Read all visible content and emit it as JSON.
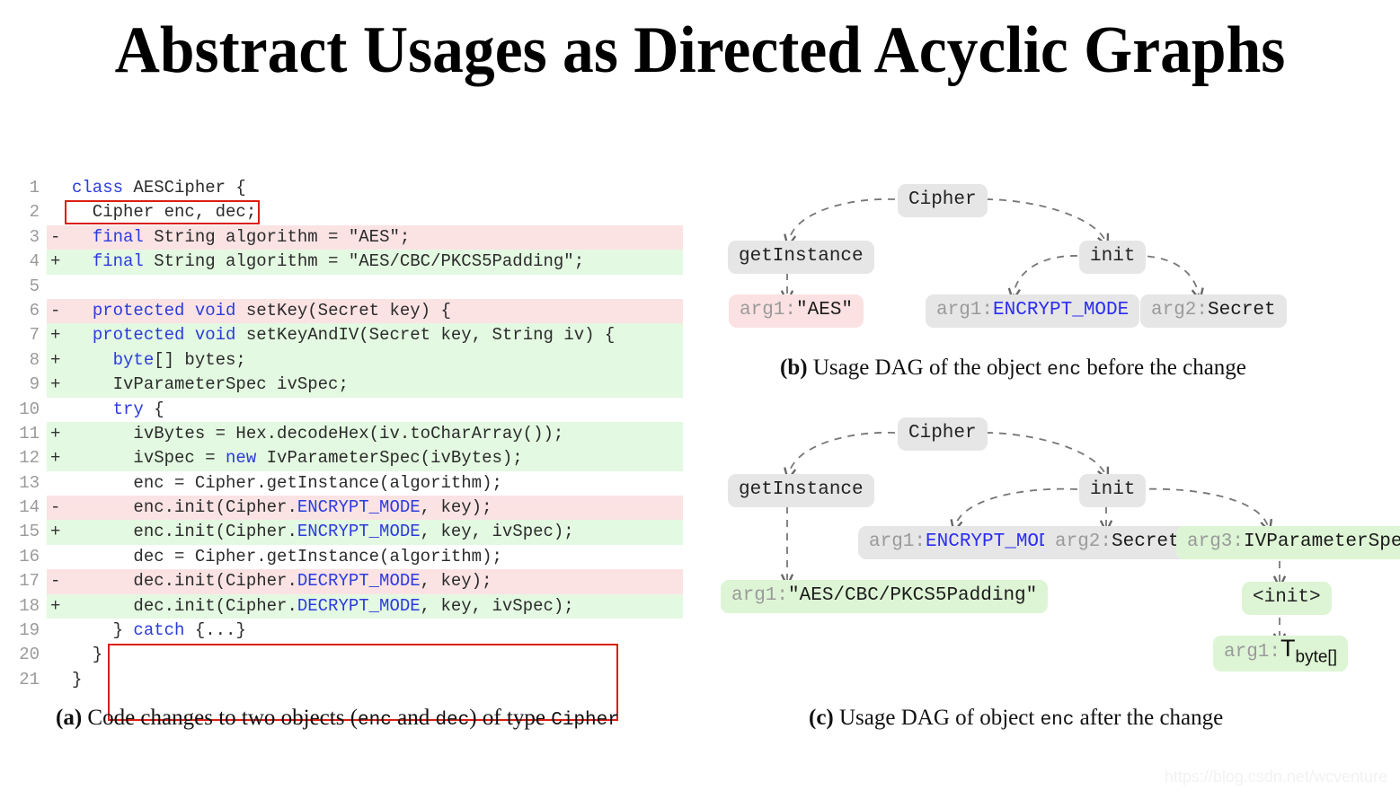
{
  "title": "Abstract Usages as Directed Acyclic Graphs",
  "code": {
    "lines": [
      {
        "n": "1",
        "sign": "",
        "type": "none",
        "text": "class AESCipher {",
        "spans": [
          {
            "t": "class",
            "c": "kw"
          },
          {
            "t": " AESCipher {",
            "c": ""
          }
        ]
      },
      {
        "n": "2",
        "sign": "",
        "type": "none",
        "text": "  Cipher enc, dec;",
        "spans": [
          {
            "t": "  Cipher enc, dec;",
            "c": ""
          }
        ]
      },
      {
        "n": "3",
        "sign": "-",
        "type": "del",
        "text": "  final String algorithm = \"AES\";",
        "spans": [
          {
            "t": "  ",
            "c": ""
          },
          {
            "t": "final",
            "c": "kw"
          },
          {
            "t": " String algorithm = \"AES\";",
            "c": ""
          }
        ]
      },
      {
        "n": "4",
        "sign": "+",
        "type": "add",
        "text": "  final String algorithm = \"AES/CBC/PKCS5Padding\";",
        "spans": [
          {
            "t": "  ",
            "c": ""
          },
          {
            "t": "final",
            "c": "kw"
          },
          {
            "t": " String algorithm = \"AES/CBC/PKCS5Padding\";",
            "c": ""
          }
        ]
      },
      {
        "n": "5",
        "sign": "",
        "type": "none",
        "text": "",
        "spans": []
      },
      {
        "n": "6",
        "sign": "-",
        "type": "del",
        "text": "  protected void setKey(Secret key) {",
        "spans": [
          {
            "t": "  ",
            "c": ""
          },
          {
            "t": "protected",
            "c": "kw"
          },
          {
            "t": " ",
            "c": ""
          },
          {
            "t": "void",
            "c": "kw"
          },
          {
            "t": " setKey(Secret key) {",
            "c": ""
          }
        ]
      },
      {
        "n": "7",
        "sign": "+",
        "type": "add",
        "text": "  protected void setKeyAndIV(Secret key, String iv) {",
        "spans": [
          {
            "t": "  ",
            "c": ""
          },
          {
            "t": "protected",
            "c": "kw"
          },
          {
            "t": " ",
            "c": ""
          },
          {
            "t": "void",
            "c": "kw"
          },
          {
            "t": " setKeyAndIV(Secret key, String iv) {",
            "c": ""
          }
        ]
      },
      {
        "n": "8",
        "sign": "+",
        "type": "add",
        "text": "    byte[] bytes;",
        "spans": [
          {
            "t": "    ",
            "c": ""
          },
          {
            "t": "byte",
            "c": "kw"
          },
          {
            "t": "[] bytes;",
            "c": ""
          }
        ]
      },
      {
        "n": "9",
        "sign": "+",
        "type": "add",
        "text": "    IvParameterSpec ivSpec;",
        "spans": [
          {
            "t": "    IvParameterSpec ivSpec;",
            "c": ""
          }
        ]
      },
      {
        "n": "10",
        "sign": "",
        "type": "none",
        "text": "    try {",
        "spans": [
          {
            "t": "    ",
            "c": ""
          },
          {
            "t": "try",
            "c": "kw"
          },
          {
            "t": " {",
            "c": ""
          }
        ]
      },
      {
        "n": "11",
        "sign": "+",
        "type": "add",
        "text": "      ivBytes = Hex.decodeHex(iv.toCharArray());",
        "spans": [
          {
            "t": "      ivBytes = Hex.decodeHex(iv.toCharArray());",
            "c": ""
          }
        ]
      },
      {
        "n": "12",
        "sign": "+",
        "type": "add",
        "text": "      ivSpec = new IvParameterSpec(ivBytes);",
        "spans": [
          {
            "t": "      ivSpec = ",
            "c": ""
          },
          {
            "t": "new",
            "c": "kw"
          },
          {
            "t": " IvParameterSpec(ivBytes);",
            "c": ""
          }
        ]
      },
      {
        "n": "13",
        "sign": "",
        "type": "none",
        "text": "      enc = Cipher.getInstance(algorithm);",
        "spans": [
          {
            "t": "      enc = Cipher.getInstance(algorithm);",
            "c": ""
          }
        ]
      },
      {
        "n": "14",
        "sign": "-",
        "type": "del",
        "text": "      enc.init(Cipher.ENCRYPT_MODE, key);",
        "spans": [
          {
            "t": "      enc.init(Cipher.",
            "c": ""
          },
          {
            "t": "ENCRYPT_MODE",
            "c": "cn"
          },
          {
            "t": ", key);",
            "c": ""
          }
        ]
      },
      {
        "n": "15",
        "sign": "+",
        "type": "add",
        "text": "      enc.init(Cipher.ENCRYPT_MODE, key, ivSpec);",
        "spans": [
          {
            "t": "      enc.init(Cipher.",
            "c": ""
          },
          {
            "t": "ENCRYPT_MODE",
            "c": "cn"
          },
          {
            "t": ", key, ivSpec);",
            "c": ""
          }
        ]
      },
      {
        "n": "16",
        "sign": "",
        "type": "none",
        "text": "      dec = Cipher.getInstance(algorithm);",
        "spans": [
          {
            "t": "      dec = Cipher.getInstance(algorithm);",
            "c": ""
          }
        ]
      },
      {
        "n": "17",
        "sign": "-",
        "type": "del",
        "text": "      dec.init(Cipher.DECRYPT_MODE, key);",
        "spans": [
          {
            "t": "      dec.init(Cipher.",
            "c": ""
          },
          {
            "t": "DECRYPT_MODE",
            "c": "cn"
          },
          {
            "t": ", key);",
            "c": ""
          }
        ]
      },
      {
        "n": "18",
        "sign": "+",
        "type": "add",
        "text": "      dec.init(Cipher.DECRYPT_MODE, key, ivSpec);",
        "spans": [
          {
            "t": "      dec.init(Cipher.",
            "c": ""
          },
          {
            "t": "DECRYPT_MODE",
            "c": "cn"
          },
          {
            "t": ", key, ivSpec);",
            "c": ""
          }
        ]
      },
      {
        "n": "19",
        "sign": "",
        "type": "none",
        "text": "    } catch {...}",
        "spans": [
          {
            "t": "    } ",
            "c": ""
          },
          {
            "t": "catch",
            "c": "kw"
          },
          {
            "t": " {...}",
            "c": ""
          }
        ]
      },
      {
        "n": "20",
        "sign": "",
        "type": "none",
        "text": "  }",
        "spans": [
          {
            "t": "  }",
            "c": ""
          }
        ]
      },
      {
        "n": "21",
        "sign": "",
        "type": "none",
        "text": "}",
        "spans": [
          {
            "t": "}",
            "c": ""
          }
        ]
      }
    ]
  },
  "captions": {
    "a_label": "(a)",
    "a_part1": " Code changes to two objects (",
    "a_mono1": "enc",
    "a_part2": " and ",
    "a_mono2": "dec",
    "a_part3": ") of type ",
    "a_mono3": "Cipher",
    "b_label": "(b)",
    "b_part1": " Usage DAG of the object ",
    "b_mono1": "enc",
    "b_part2": " before the change",
    "c_label": "(c)",
    "c_part1": " Usage DAG of object ",
    "c_mono1": "enc",
    "c_part2": " after the change"
  },
  "dag_b": {
    "nodes": {
      "cipher": "Cipher",
      "getInstance": "getInstance",
      "init": "init",
      "arg1_aes_prefix": "arg1:",
      "arg1_aes_value": "\"AES\"",
      "arg1_enc_prefix": "arg1:",
      "arg1_enc_value": "ENCRYPT_MODE",
      "arg2_sec_prefix": "arg2:",
      "arg2_sec_value": "Secret"
    }
  },
  "dag_c": {
    "nodes": {
      "cipher": "Cipher",
      "getInstance": "getInstance",
      "init": "init",
      "arg1_alg_prefix": "arg1:",
      "arg1_alg_value": "\"AES/CBC/PKCS5Padding\"",
      "arg1_enc_prefix": "arg1:",
      "arg1_enc_value": "ENCRYPT_MODE",
      "arg2_sec_prefix": "arg2:",
      "arg2_sec_value": "Secret",
      "arg3_ivp_prefix": "arg3:",
      "arg3_ivp_value": "IVParameterSpec",
      "initctor": "<init>",
      "arg1_t_prefix": "arg1:",
      "arg1_t_base": "T",
      "arg1_t_sub": "byte[]"
    }
  },
  "watermark": "https://blog.csdn.net/wcventure",
  "colors": {
    "diff_add": "#e3f9e1",
    "diff_del": "#fbe3e4",
    "highlight_box": "#d91f12",
    "keyword": "#2b3bdd",
    "node_grey": "#e6e6e6",
    "node_green": "#ddf5d5",
    "node_pink": "#fbe1e1"
  }
}
